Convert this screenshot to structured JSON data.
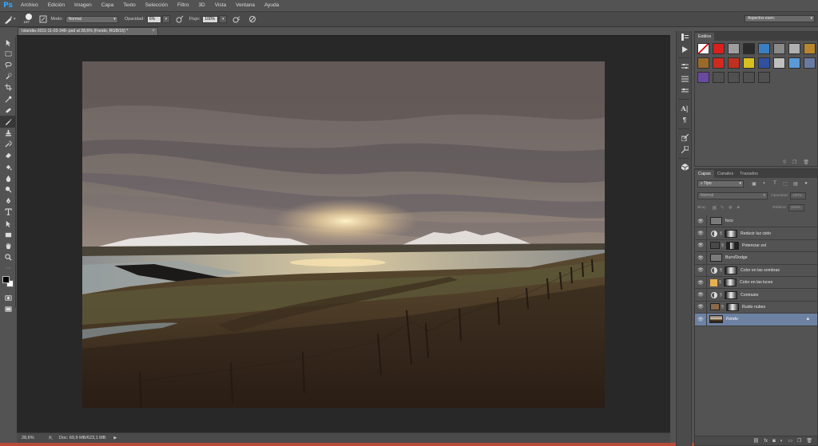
{
  "app": {
    "logo": "Ps",
    "menu": [
      "Archivo",
      "Edición",
      "Imagen",
      "Capa",
      "Texto",
      "Selección",
      "Filtro",
      "3D",
      "Vista",
      "Ventana",
      "Ayuda"
    ]
  },
  "options": {
    "brush_size": "197",
    "mode_label": "Modo:",
    "mode_value": "Normal",
    "opacity_label": "Opacidad:",
    "opacity_value": "6%",
    "flow_label": "Flujo:",
    "flow_value": "100%",
    "workspace": "Aspectos esen."
  },
  "document": {
    "tab_title": "Islandia-2011-11-03-348-.psd al 28,6% (Fondo, RGB/16) *",
    "tab_close": "×"
  },
  "status": {
    "zoom": "28,6%",
    "doc_info": "Doc: 69,9 MB/623,1 MB",
    "arrow": "▶"
  },
  "styles_panel": {
    "tab": "Estilos",
    "swatches": [
      "#e8e8e8",
      "#d9201e",
      "#9e9e9e",
      "#2a2a2a",
      "#3a7fc1",
      "#8a8a8a",
      "#b0b0b0",
      "#b8862e",
      "#9a6a2a",
      "#d02a20",
      "#c03020",
      "#d8c020",
      "#3050a0",
      "#c0c0c0",
      "#5a9ad8",
      "#6a7aa0",
      "#6a4aa0",
      "#505050",
      "#505050",
      "#505050",
      "#505050"
    ]
  },
  "layers_panel": {
    "tabs": [
      "Capas",
      "Canales",
      "Trazados"
    ],
    "filter_label": "Tipo",
    "blend_mode": "Normal",
    "opacity_label": "Opacidad:",
    "opacity_value": "100%",
    "lock_label": "Bloq.:",
    "fill_label": "Relleno:",
    "fill_value": "100%",
    "layers": [
      {
        "name": "foco",
        "type": "group",
        "color": "#7a7a7a"
      },
      {
        "name": "Reducir luz cielo",
        "type": "adjustment",
        "color": "#d8d8d8"
      },
      {
        "name": "Potenciar sol",
        "type": "pixel",
        "color": "#4a4a4a"
      },
      {
        "name": "Burn/Dodge",
        "type": "group",
        "color": "#7a7a7a"
      },
      {
        "name": "Color en las sombras",
        "type": "adjustment",
        "color": "#d8d8d8"
      },
      {
        "name": "Color en las luces",
        "type": "solid",
        "color": "#e8b050"
      },
      {
        "name": "Contraste",
        "type": "adjustment",
        "color": "#d8d8d8"
      },
      {
        "name": "Ruido nubes",
        "type": "photo",
        "color": "#8a6a4a"
      },
      {
        "name": "Fondo",
        "type": "background",
        "color": "#6a5a4a",
        "selected": true,
        "locked": true
      }
    ]
  }
}
